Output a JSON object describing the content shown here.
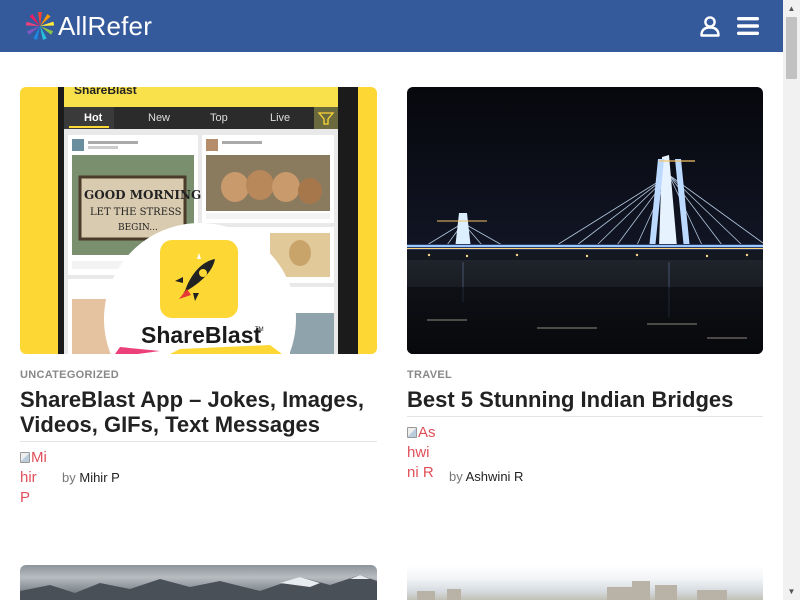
{
  "header": {
    "logo_text": "AllRefer",
    "logo_icon": "starburst-logo-icon",
    "user_icon": "user-icon",
    "menu_icon": "hamburger-menu-icon",
    "bg_color": "#355a9c"
  },
  "posts": [
    {
      "category": "UNCATEGORIZED",
      "title": "ShareBlast App – Jokes, Images, Videos, GIFs, Text Messages",
      "author_prefix": "by",
      "author": "Mihir P",
      "avatar_alt": "Mihir P",
      "thumbnail": {
        "app_name": "ShareBlast",
        "tabs": [
          "Hot",
          "New",
          "Top",
          "Live"
        ],
        "sign_text": "GOOD MORNING.. LET THE STRESS BEGIN..",
        "badge_text": "ShareBlast",
        "accent_color": "#fdd835"
      }
    },
    {
      "category": "TRAVEL",
      "title": "Best 5 Stunning Indian Bridges",
      "author_prefix": "by",
      "author": "Ashwini R",
      "avatar_alt": "Ashwini R"
    }
  ],
  "scrollbar": {
    "up_icon": "scroll-up-arrow-icon",
    "down_icon": "scroll-down-arrow-icon"
  }
}
